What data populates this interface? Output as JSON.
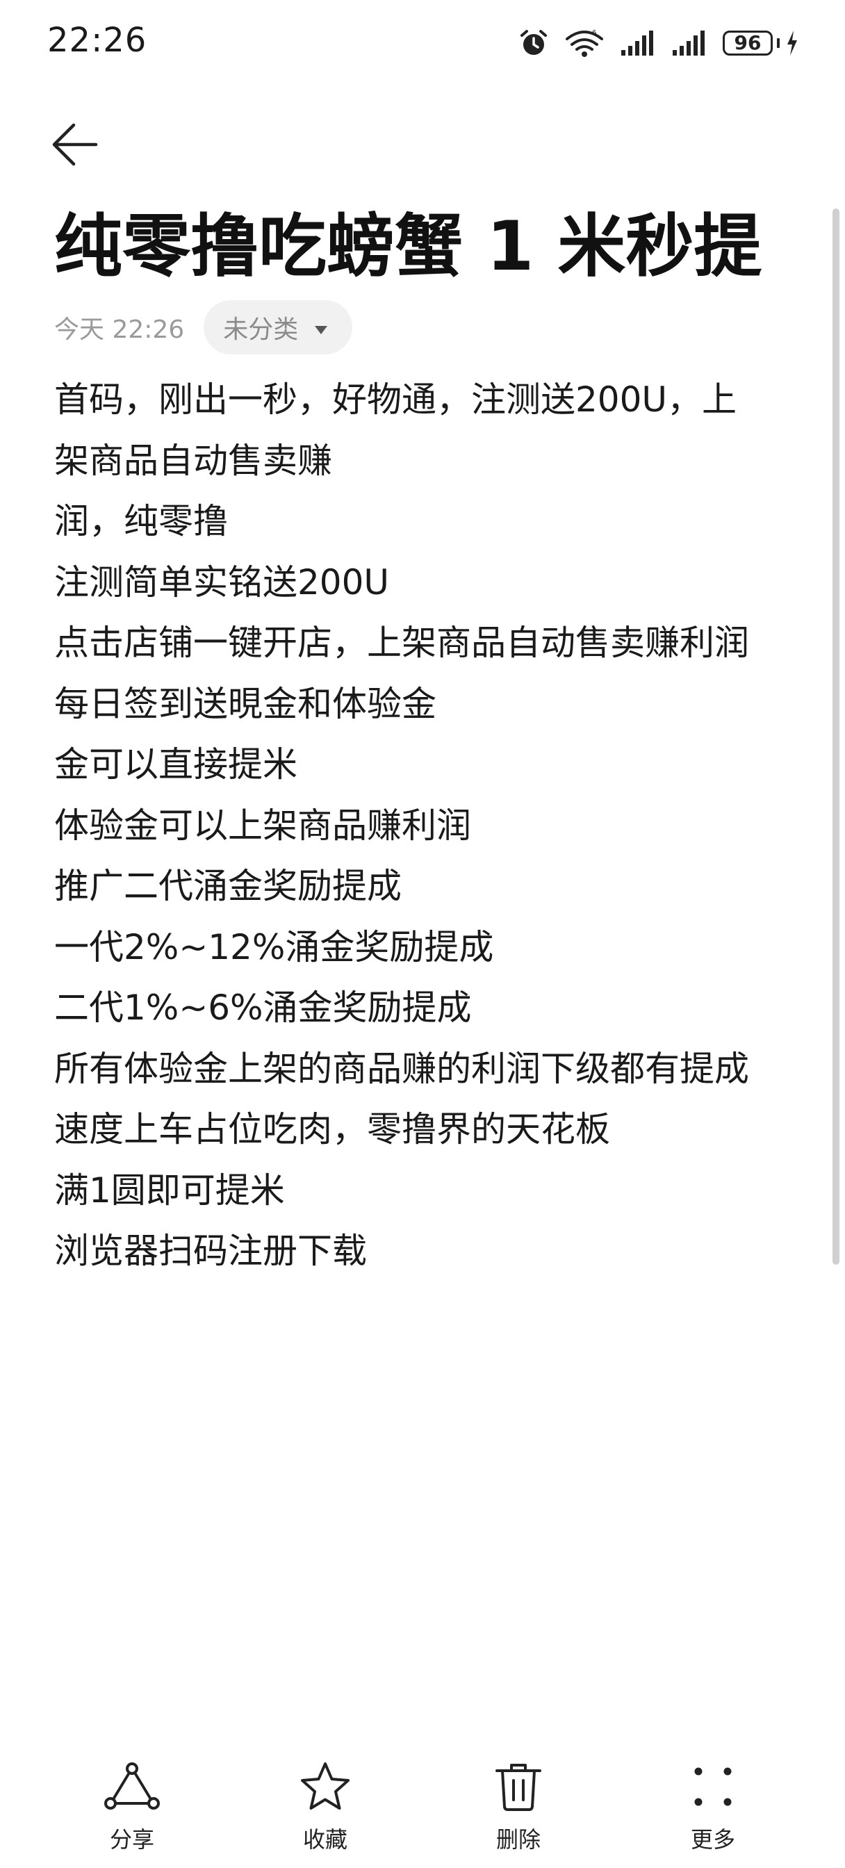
{
  "status_bar": {
    "time": "22:26",
    "battery": "96",
    "icons": [
      "alarm-icon",
      "wifi-icon",
      "signal-icon-1",
      "signal-icon-2",
      "battery-icon",
      "charging-icon"
    ]
  },
  "header": {
    "back_icon": "back-arrow-icon"
  },
  "note": {
    "title": "纯零撸吃螃蟹 1 米秒提",
    "date": "今天 22:26",
    "category": "未分类",
    "lines": [
      "首码，刚出一秒，好物通，注测送200U，上",
      "架商品自动售卖赚",
      "润，纯零撸",
      "注测简单实铭送200U",
      "点击店铺一键开店，上架商品自动售卖赚利润",
      "每日签到送晛金和体验金",
      "金可以直接提米",
      "体验金可以上架商品赚利润",
      "推广二代涌金奖励提成",
      "一代2%~12%涌金奖励提成",
      "二代1%~6%涌金奖励提成",
      "所有体验金上架的商品赚的利润下级都有提成",
      "速度上车占位吃肉，零撸界的天花板",
      "满1圆即可提米",
      "浏览器扫码注册下载"
    ]
  },
  "toolbar": {
    "share_label": "分享",
    "favorite_label": "收藏",
    "delete_label": "删除",
    "more_label": "更多"
  }
}
